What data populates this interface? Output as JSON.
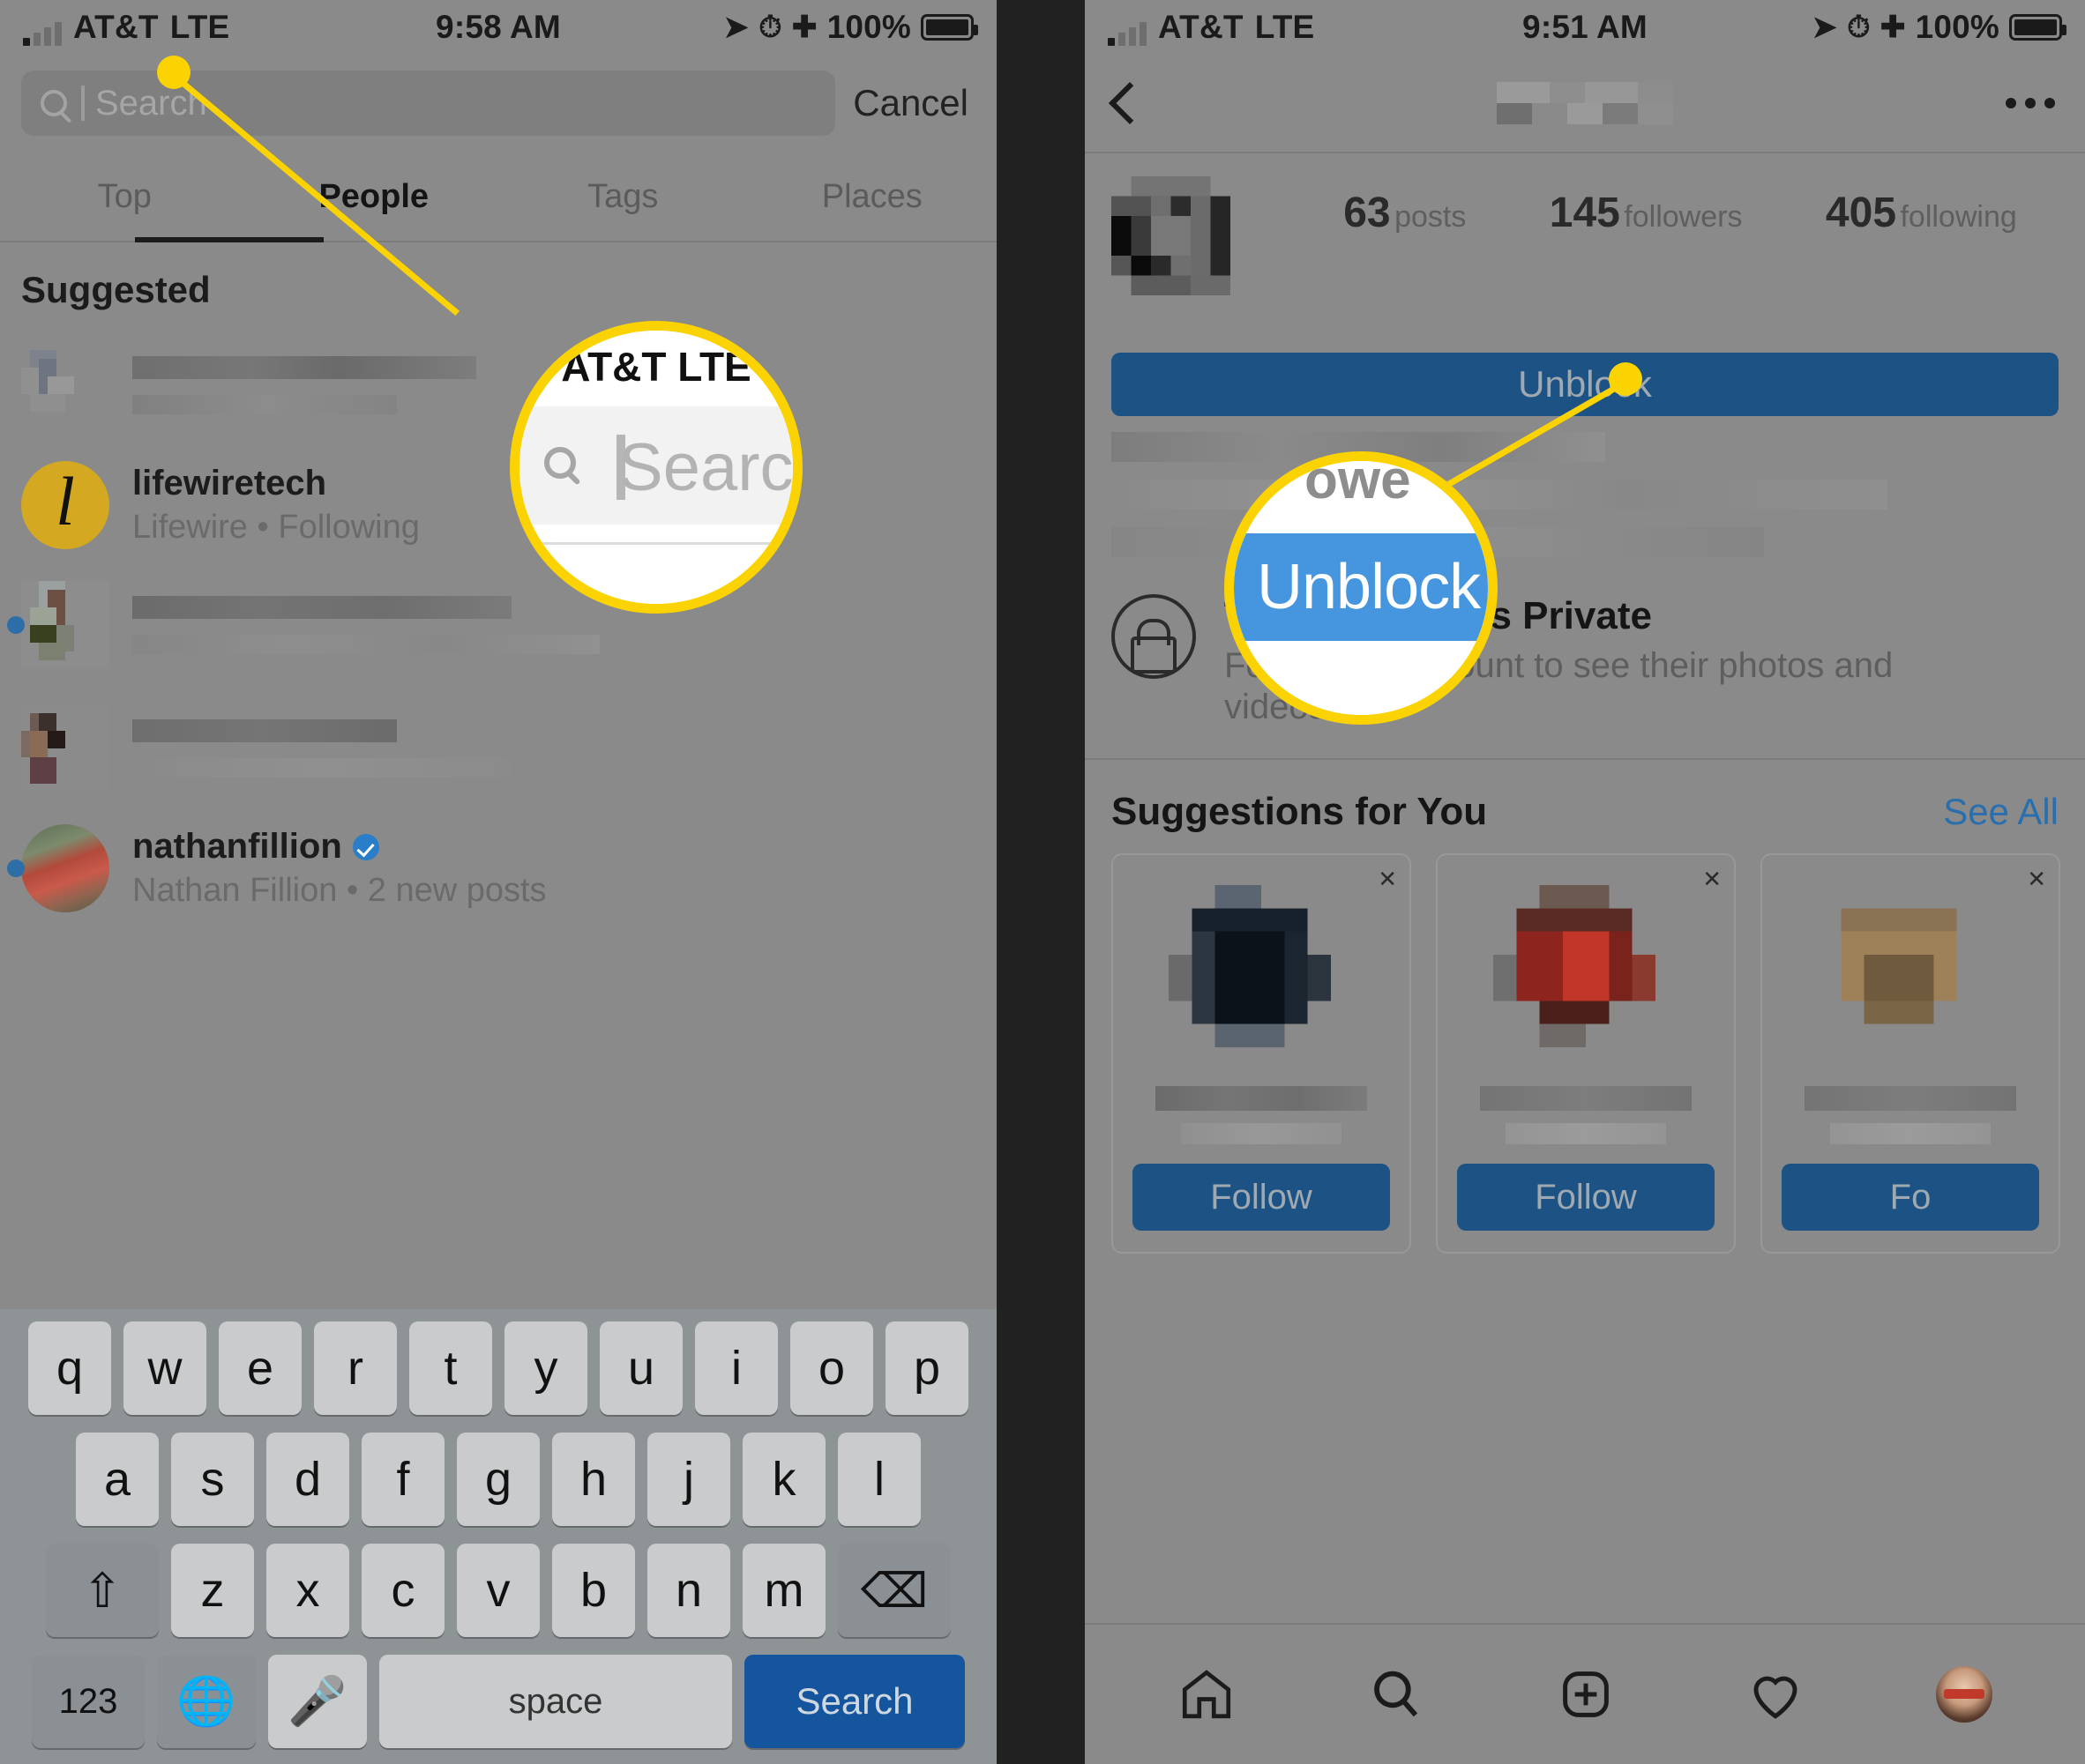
{
  "left_phone": {
    "status_bar": {
      "carrier": "AT&T",
      "network": "LTE",
      "time": "9:58 AM",
      "battery_percent": "100%",
      "icons": [
        "location-arrow-icon",
        "alarm-clock-icon",
        "bluetooth-icon",
        "battery-icon"
      ]
    },
    "search": {
      "placeholder": "Search",
      "value": "",
      "cancel_label": "Cancel"
    },
    "tabs": [
      {
        "label": "Top",
        "active": false
      },
      {
        "label": "People",
        "active": true
      },
      {
        "label": "Tags",
        "active": false
      },
      {
        "label": "Places",
        "active": false
      }
    ],
    "section_title": "Suggested",
    "results": [
      {
        "username": "",
        "subtitle": "",
        "blurred": true,
        "verified": false,
        "unread": false
      },
      {
        "username": "lifewiretech",
        "subtitle": "Lifewire • Following",
        "blurred": false,
        "verified": false,
        "unread": false
      },
      {
        "username": "",
        "subtitle": "",
        "blurred": true,
        "verified": false,
        "unread": true
      },
      {
        "username": "",
        "subtitle": "",
        "blurred": true,
        "verified": false,
        "unread": false
      },
      {
        "username": "nathanfillion",
        "subtitle": "Nathan Fillion • 2 new posts",
        "blurred": false,
        "verified": true,
        "unread": true
      }
    ],
    "keyboard": {
      "row1": [
        "q",
        "w",
        "e",
        "r",
        "t",
        "y",
        "u",
        "i",
        "o",
        "p"
      ],
      "row2": [
        "a",
        "s",
        "d",
        "f",
        "g",
        "h",
        "j",
        "k",
        "l"
      ],
      "row3": [
        "z",
        "x",
        "c",
        "v",
        "b",
        "n",
        "m"
      ],
      "shift_icon": "shift-up-arrow-icon",
      "backspace_icon": "backspace-delete-icon",
      "numbers_key": "123",
      "globe_icon": "globe-language-icon",
      "mic_icon": "microphone-icon",
      "space_label": "space",
      "action_label": "Search"
    }
  },
  "right_phone": {
    "status_bar": {
      "carrier": "AT&T",
      "network": "LTE",
      "time": "9:51 AM",
      "battery_percent": "100%",
      "icons": [
        "location-arrow-icon",
        "alarm-clock-icon",
        "bluetooth-icon",
        "battery-icon"
      ]
    },
    "nav": {
      "back_icon": "chevron-left-icon",
      "title": "",
      "title_blurred": true,
      "more_icon": "ellipsis-horizontal-icon"
    },
    "profile": {
      "avatar_blurred": true,
      "stats": [
        {
          "value": "63",
          "label": "posts"
        },
        {
          "value": "145",
          "label": "followers"
        },
        {
          "value": "405",
          "label": "following"
        }
      ],
      "action_button": "Unblock",
      "bio_blurred": true
    },
    "private_notice": {
      "icon": "lock-icon",
      "title": "This Account is Private",
      "body": "Follow this account to see their photos and videos."
    },
    "suggestions": {
      "heading": "Suggestions for You",
      "see_all": "See All",
      "cards": [
        {
          "name": "",
          "subtitle": "",
          "follow_label": "Follow",
          "blurred": true,
          "close_icon": "close-x-icon"
        },
        {
          "name": "",
          "subtitle": "",
          "follow_label": "Follow",
          "blurred": true,
          "close_icon": "close-x-icon"
        },
        {
          "name": "",
          "subtitle": "",
          "follow_label": "Fo",
          "blurred": true,
          "close_icon": "close-x-icon"
        }
      ]
    },
    "tabbar": [
      {
        "name": "home-icon"
      },
      {
        "name": "search-icon"
      },
      {
        "name": "add-post-icon"
      },
      {
        "name": "heart-activity-icon"
      },
      {
        "name": "profile-avatar-icon"
      }
    ]
  },
  "callouts": [
    {
      "id": "search-callout",
      "target": "search-input",
      "magnified_text": "Search",
      "magnified_context": "AT&T LTE",
      "ring_color": "#fbd303"
    },
    {
      "id": "unblock-callout",
      "target": "unblock-button",
      "magnified_text": "Unblock",
      "magnified_context": "owe",
      "ring_color": "#fbd303"
    }
  ],
  "colors": {
    "highlight": "#fbd303",
    "instagram_blue": "#3897f0",
    "button_blue_dimmed": "#1c5384",
    "link_blue": "#2a6fad",
    "dim_overlay": "#8a8a8a"
  }
}
